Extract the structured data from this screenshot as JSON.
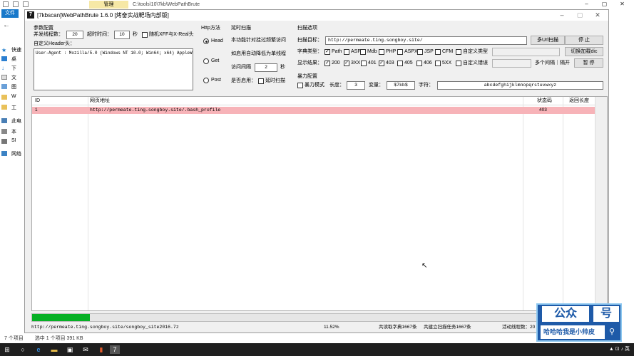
{
  "explorer": {
    "ribbon_file_tab": "文件",
    "manage_tab": "管理",
    "path": "C:\\tools\\10\\7kb\\WebPathBrute",
    "sidebar": [
      {
        "label": "快速"
      },
      {
        "label": "桌"
      },
      {
        "label": "下"
      },
      {
        "label": "文"
      },
      {
        "label": "图"
      },
      {
        "label": "W"
      },
      {
        "label": "工"
      },
      {
        "label": "此电"
      },
      {
        "label": "本"
      },
      {
        "label": "Sl"
      },
      {
        "label": "网络"
      }
    ],
    "status": {
      "items": "7 个项目",
      "selected": "选中 1 个项目  391 KB"
    }
  },
  "window": {
    "icon_glyph": "7",
    "title": "[7kbscan]WebPathBrute 1.6.0 [烤奋实战靶场内部版]"
  },
  "params": {
    "group_label": "参数配置",
    "threads_label": "并发线程数：",
    "threads_value": "20",
    "timeout_label": "超时时间：",
    "timeout_value": "10",
    "timeout_unit": "秒",
    "random_xff_label": "随机XFF与X-Real头",
    "random_xff_checked": false,
    "custom_header_label": "自定义Header头：",
    "header_value": "User-Agent : Mozilla/5.0 (Windows NT 10.0; Win64; x64) AppleWebKi"
  },
  "http": {
    "group_label": "Http方法",
    "methods": [
      {
        "label": "Head",
        "checked": true
      },
      {
        "label": "Get",
        "checked": false
      },
      {
        "label": "Post",
        "checked": false
      }
    ]
  },
  "delay": {
    "group_label": "延时扫描",
    "desc1": "本功能针对挂过频繁访问",
    "desc2": "如启用自动降低为单线程",
    "interval_label": "访问间隔",
    "interval_value": "2",
    "interval_unit": "秒",
    "enable_label": "是否启用：",
    "enable_cb_label": "延时扫描",
    "enable_checked": false
  },
  "scan": {
    "group_label": "扫描选项",
    "target_label": "扫描目标：",
    "target_value": "http://permeate.ting.songboy.site/",
    "multi_url_button": "多Url扫描",
    "stop_button": "停 止",
    "dict_label": "字典类型：",
    "dict_types": [
      {
        "label": "Path",
        "checked": true
      },
      {
        "label": "ASP",
        "checked": false
      },
      {
        "label": "Mdb",
        "checked": false
      },
      {
        "label": "PHP",
        "checked": false
      },
      {
        "label": "ASPX",
        "checked": false
      },
      {
        "label": "JSP",
        "checked": false
      },
      {
        "label": "CFM",
        "checked": false
      },
      {
        "label": "自定义类型",
        "checked": false
      }
    ],
    "switch_dict_button": "切换加载dic",
    "result_label": "显示结果：",
    "result_types": [
      {
        "label": "200",
        "checked": true
      },
      {
        "label": "3XX",
        "checked": true
      },
      {
        "label": "401",
        "checked": false
      },
      {
        "label": "403",
        "checked": true
      },
      {
        "label": "405",
        "checked": false
      },
      {
        "label": "406",
        "checked": false
      },
      {
        "label": "5XX",
        "checked": false
      },
      {
        "label": "自定义错误",
        "checked": false
      }
    ],
    "multi_select_label": "多个间隔｜隔开",
    "pause_button": "暂 停"
  },
  "brute": {
    "group_label": "暴力配置",
    "mode_label": "暴力模式",
    "mode_checked": false,
    "length_label": "长度：",
    "length_value": "3",
    "variable_label": "变量：",
    "variable_value": "$7kb$",
    "charset_label": "字符：",
    "charset_value": "abcdefghijklmnopqrstuvwxyz"
  },
  "table": {
    "headers": [
      "ID",
      "网页地址",
      "状态码",
      "返回长度"
    ],
    "rows": [
      {
        "id": "1",
        "url": "http://permeate.ting.songboy.site/.bash_profile",
        "status": "403",
        "length": ""
      }
    ]
  },
  "progress": {
    "fraction": 0.1
  },
  "status": {
    "current_url": "http://permeate.ting.songboy.site/songboy_site2016.7z",
    "percent": "11.52%",
    "dict_read": "共读取字典1667条",
    "tasks_built": "共建立扫描任务1667条",
    "active_threads": "活动线程数：20"
  },
  "watermark": {
    "line1_a": "公众",
    "line1_b": "号",
    "line2": "哈哈哈我是小帅皮"
  },
  "taskbar": {
    "clock": "▲ ⊡ ♪ 英"
  }
}
